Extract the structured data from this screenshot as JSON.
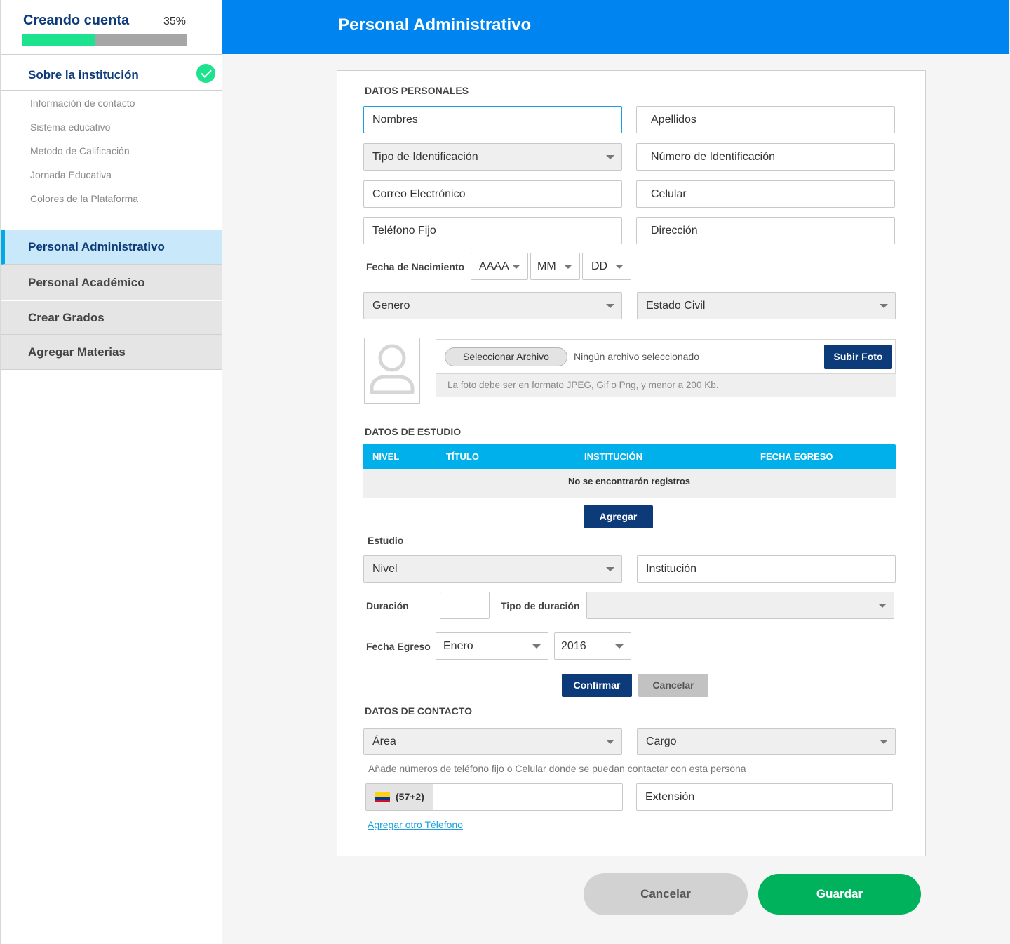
{
  "progress": {
    "title": "Creando cuenta",
    "percent_label": "35%",
    "percent": 0.44
  },
  "sidebar": {
    "done_section": "Sobre la institución",
    "sub_items": [
      "Información de contacto",
      "Sistema educativo",
      "Metodo de Calificación",
      "Jornada Educativa",
      "Colores de la Plataforma"
    ],
    "items": [
      {
        "label": "Personal Administrativo",
        "active": true
      },
      {
        "label": "Personal Académico"
      },
      {
        "label": "Crear Grados"
      },
      {
        "label": "Agregar Materias"
      }
    ]
  },
  "header": {
    "title": "Personal Administrativo"
  },
  "personal": {
    "section": "DATOS PERSONALES",
    "nombres": "Nombres",
    "apellidos": "Apellidos",
    "tipo_id": "Tipo de Identificación",
    "numero_id": "Número de Identificación",
    "correo": "Correo Electrónico",
    "celular": "Celular",
    "telefono_fijo": "Teléfono Fijo",
    "direccion": "Dirección",
    "fecha_label": "Fecha de Nacimiento",
    "year": "AAAA",
    "month": "MM",
    "day": "DD",
    "genero": "Genero",
    "estado_civil": "Estado Civil"
  },
  "photo": {
    "select_label": "Seleccionar Archivo",
    "no_file": "Ningún archivo seleccionado",
    "upload_label": "Subir Foto",
    "hint": "La foto debe ser en formato  JPEG, Gif o Png, y menor a 200 Kb."
  },
  "study": {
    "section": "DATOS DE ESTUDIO",
    "columns": [
      "NIVEL",
      "TÍTULO",
      "INSTITUCIÓN",
      "FECHA EGRESO"
    ],
    "empty": "No se encontrarón registros",
    "add_label": "Agregar",
    "form_title": "Estudio",
    "nivel": "Nivel",
    "institucion": "Institución",
    "duracion_label": "Duración",
    "tipo_duracion_label": "Tipo de duración",
    "fecha_egreso_label": "Fecha Egreso",
    "month": "Enero",
    "year": "2016",
    "confirm_label": "Confirmar",
    "cancel_label": "Cancelar"
  },
  "contact": {
    "section": "DATOS DE CONTACTO",
    "area": "Área",
    "cargo": "Cargo",
    "hint": "Añade números de teléfono fijo o Celular donde se puedan contactar con esta persona",
    "prefix": "(57+2)",
    "extension": "Extensión",
    "add_phone": "Agregar otro Télefono"
  },
  "footer": {
    "cancel": "Cancelar",
    "save": "Guardar"
  },
  "colors": {
    "header": "#0085f0",
    "accent_green": "#00b25c",
    "progress": "#1de38e",
    "navy": "#0d3b7a",
    "table_head": "#00b0ea"
  }
}
